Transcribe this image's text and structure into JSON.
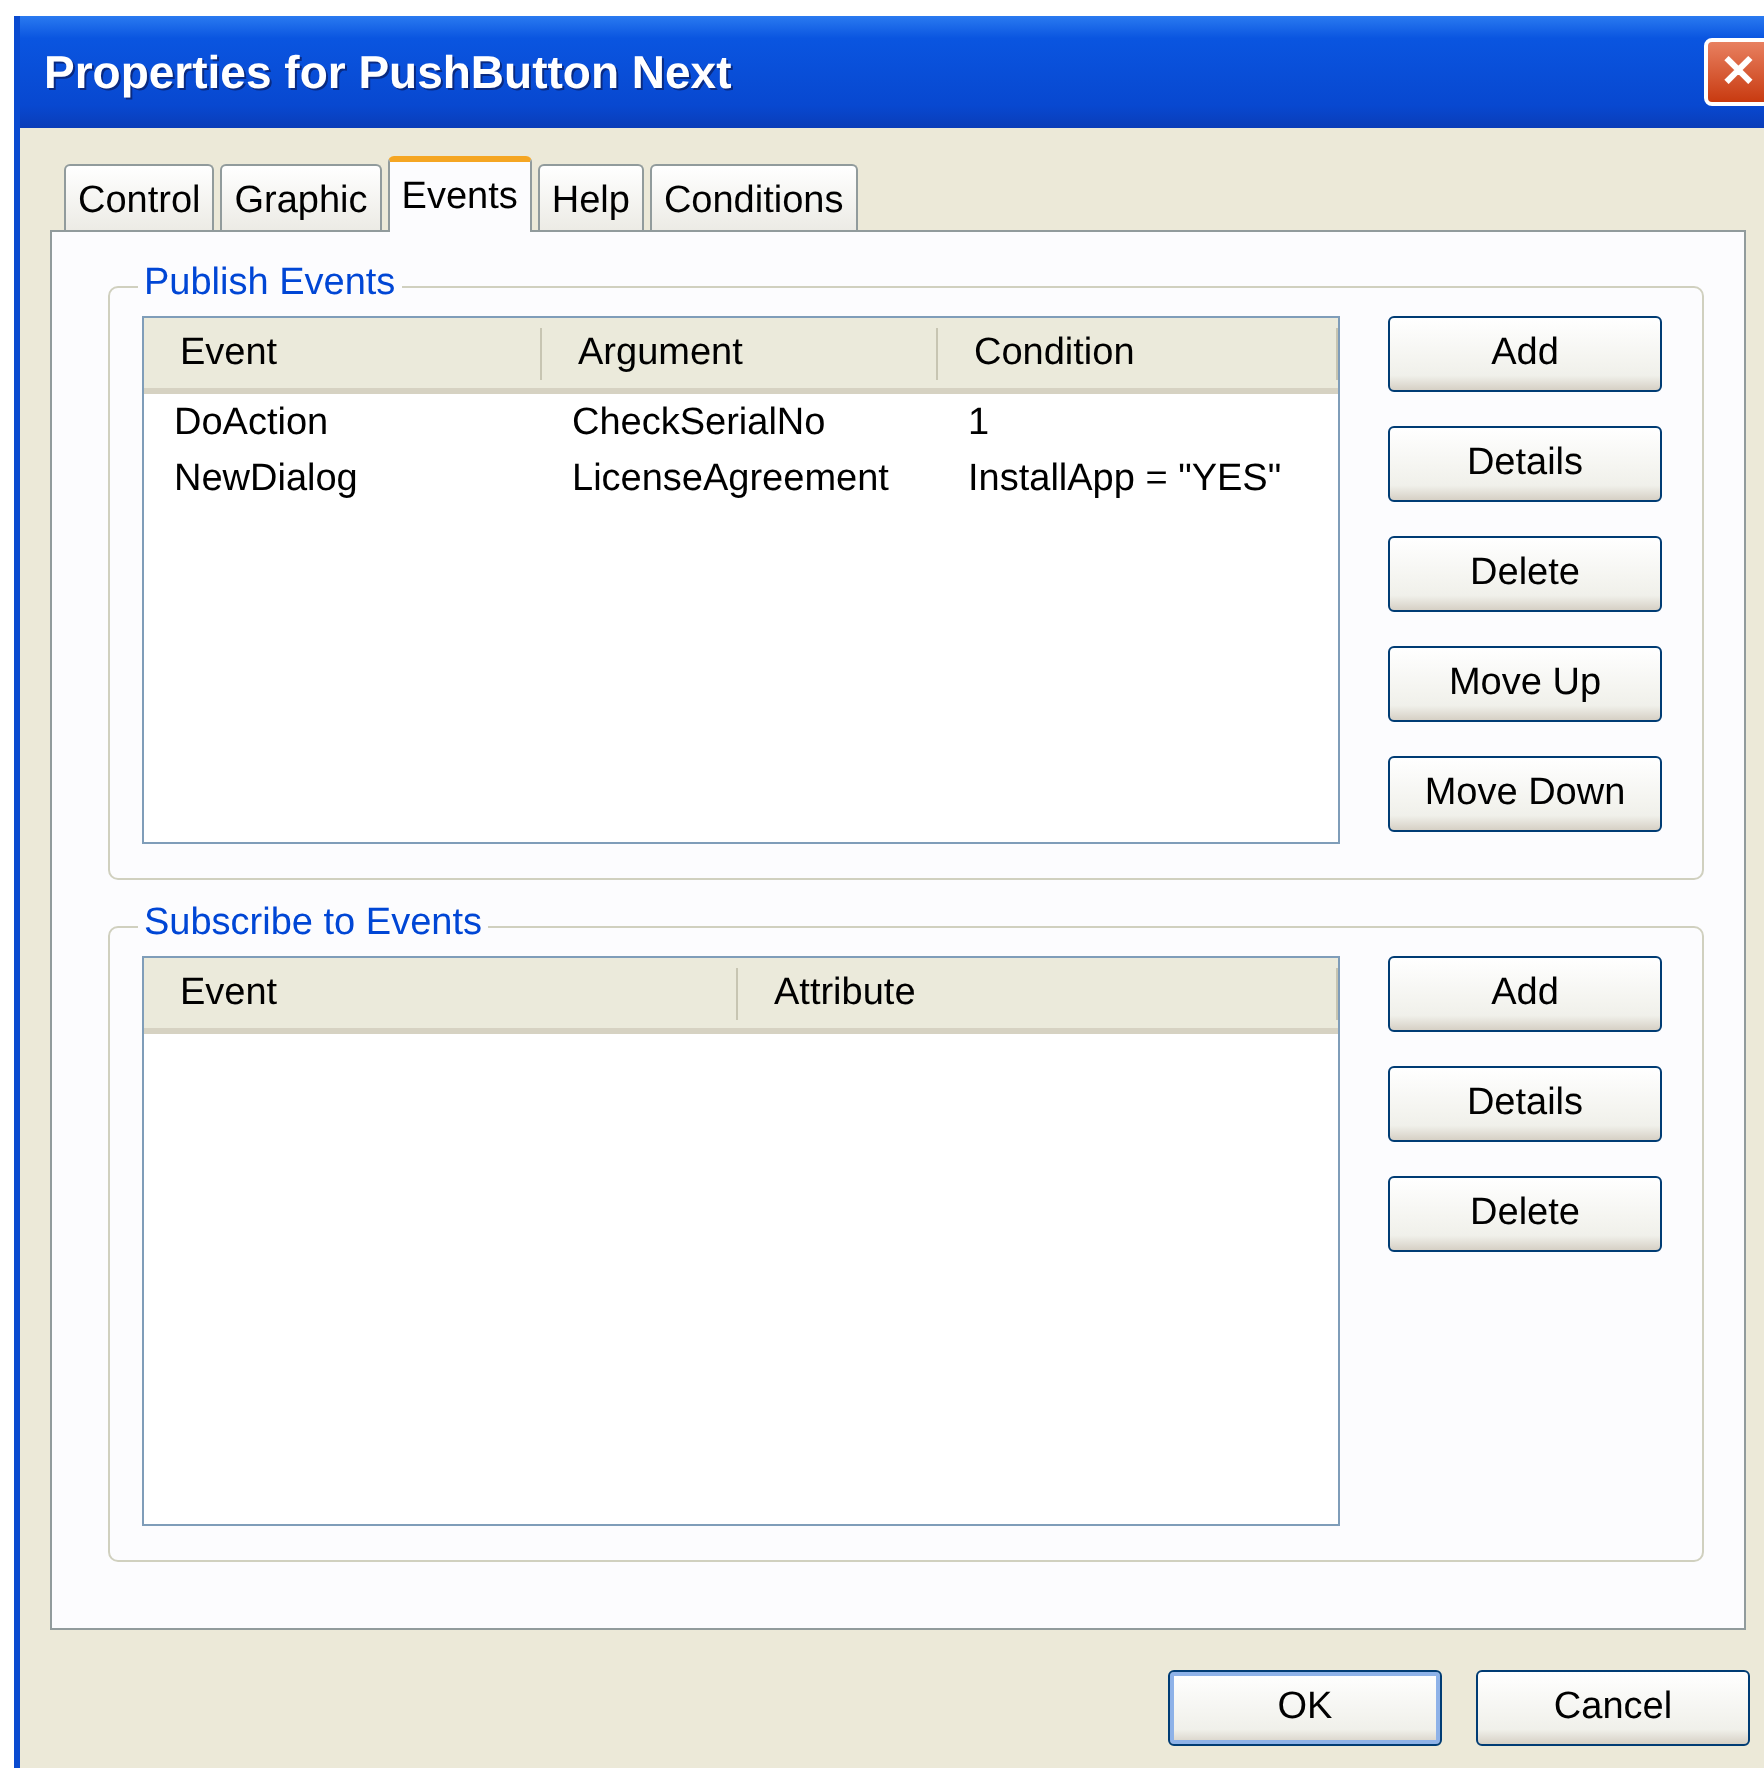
{
  "window": {
    "title": "Properties for PushButton Next",
    "close": "✕"
  },
  "tabs": [
    {
      "label": "Control",
      "selected": false
    },
    {
      "label": "Graphic",
      "selected": false
    },
    {
      "label": "Events",
      "selected": true
    },
    {
      "label": "Help",
      "selected": false
    },
    {
      "label": "Conditions",
      "selected": false
    }
  ],
  "publish_events": {
    "title": "Publish Events",
    "columns": [
      "Event",
      "Argument",
      "Condition"
    ],
    "rows": [
      [
        "DoAction",
        "CheckSerialNo",
        "1"
      ],
      [
        "NewDialog",
        "LicenseAgreement",
        "InstallApp = \"YES\""
      ]
    ],
    "buttons": [
      "Add",
      "Details",
      "Delete",
      "Move Up",
      "Move Down"
    ]
  },
  "subscribe_events": {
    "title": "Subscribe to Events",
    "columns": [
      "Event",
      "Attribute"
    ],
    "buttons": [
      "Add",
      "Details",
      "Delete"
    ]
  },
  "footer_buttons": [
    {
      "label": "OK",
      "default": true
    },
    {
      "label": "Cancel",
      "default": false
    }
  ]
}
